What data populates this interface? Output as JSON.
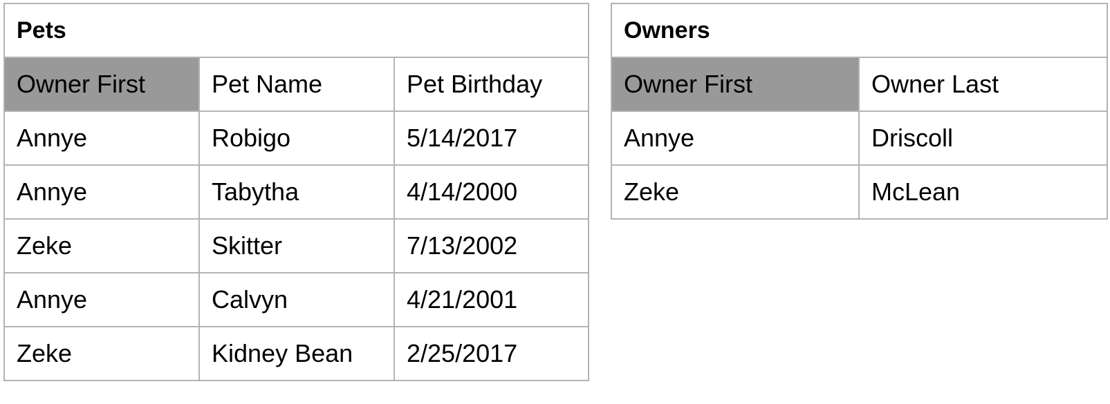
{
  "pets": {
    "title": "Pets",
    "headers": [
      "Owner First",
      "Pet Name",
      "Pet Birthday"
    ],
    "rows": [
      [
        "Annye",
        "Robigo",
        "5/14/2017"
      ],
      [
        "Annye",
        "Tabytha",
        "4/14/2000"
      ],
      [
        "Zeke",
        "Skitter",
        "7/13/2002"
      ],
      [
        "Annye",
        "Calvyn",
        "4/21/2001"
      ],
      [
        "Zeke",
        "Kidney Bean",
        "2/25/2017"
      ]
    ]
  },
  "owners": {
    "title": "Owners",
    "headers": [
      "Owner First",
      "Owner Last"
    ],
    "rows": [
      [
        "Annye",
        "Driscoll"
      ],
      [
        "Zeke",
        "McLean"
      ]
    ]
  },
  "colors": {
    "key_header_fill": "#999999",
    "border": "#b3b3b3"
  }
}
